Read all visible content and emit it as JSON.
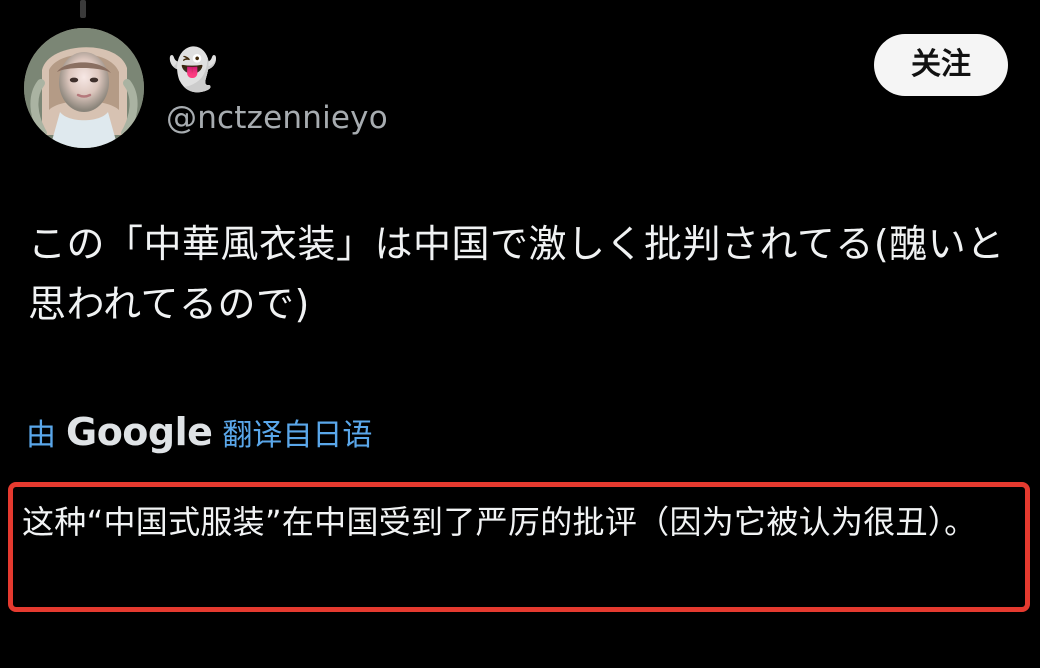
{
  "tweet": {
    "display_name": "👻",
    "handle": "@nctzennieyo",
    "follow_label": "关注",
    "original_text": "この「中華風衣装」は中国で激しく批判されてる(醜いと思われてるので)",
    "translation_prefix": "由",
    "translation_brand": "Google",
    "translation_suffix": "翻译自日语",
    "translated_text": "这种“中国式服装”在中国受到了严厉的批评（因为它被认为很丑）。"
  },
  "colors": {
    "background": "#000000",
    "accent_blue": "#5aa7ea",
    "highlight_red": "#e53a2f",
    "follow_button": "#f5f5f5"
  },
  "icons": {
    "avatar": "profile-photo",
    "display_name": "ghost-emoji"
  }
}
